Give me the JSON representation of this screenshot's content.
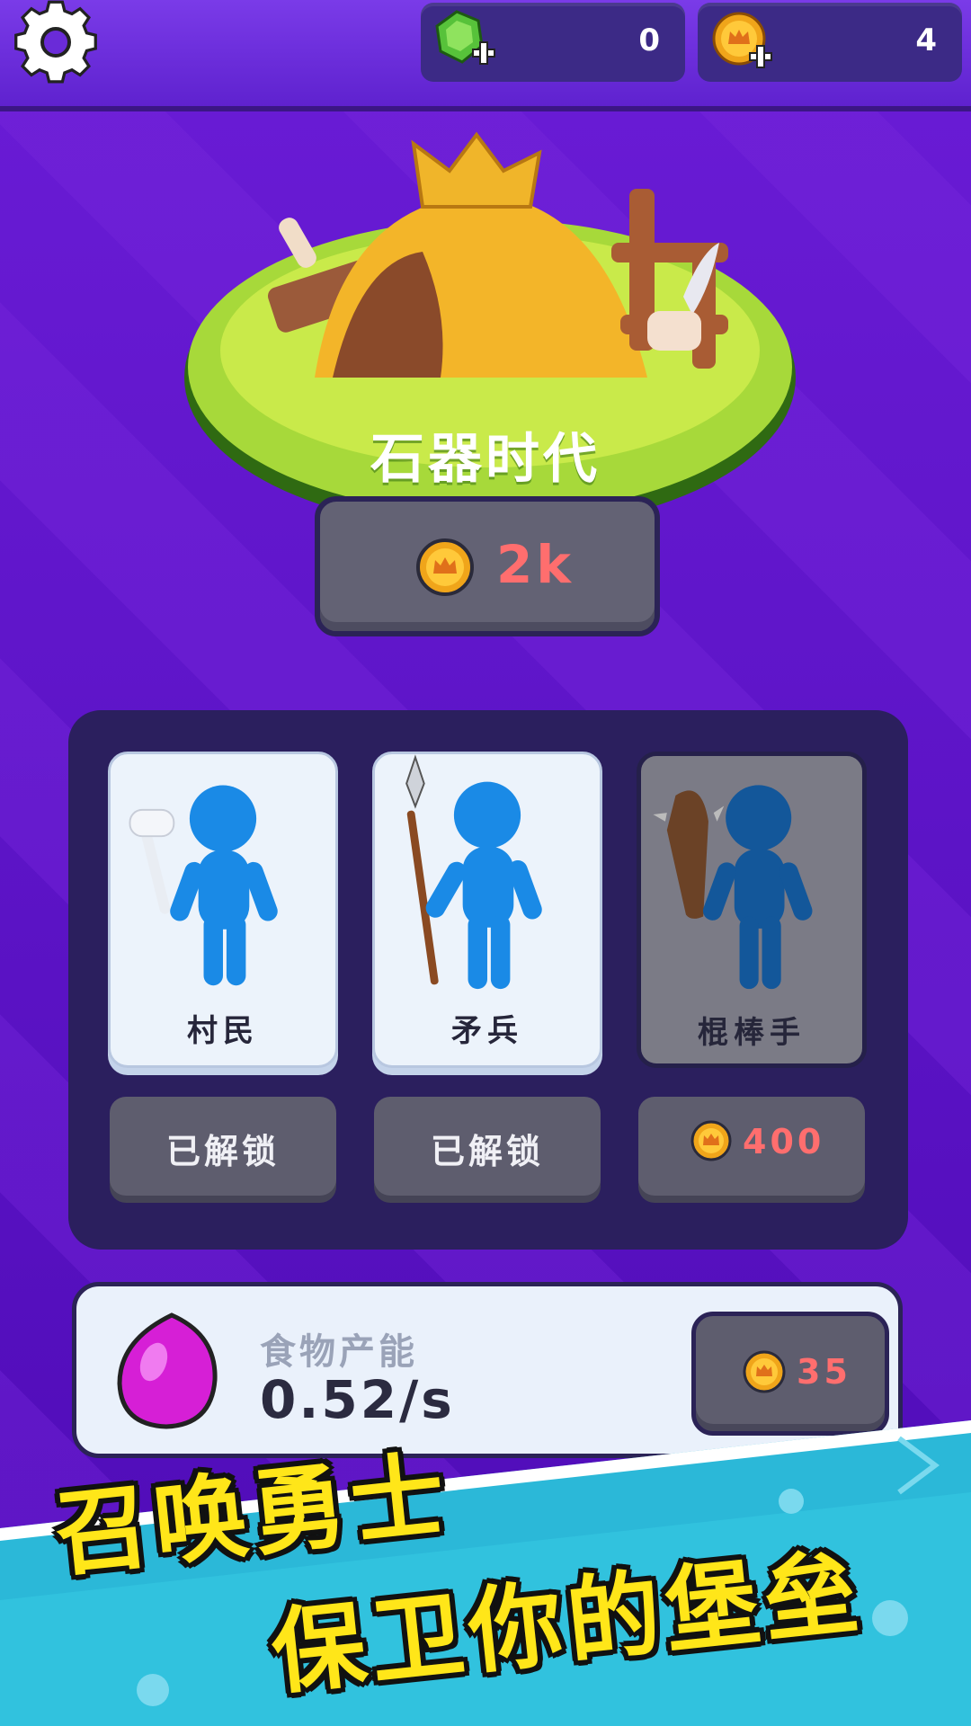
{
  "resources": {
    "gems": "0",
    "coins": "4"
  },
  "era": {
    "title": "石器时代",
    "price": "2k"
  },
  "units": [
    {
      "name": "村民",
      "status": "已解锁",
      "locked": false
    },
    {
      "name": "矛兵",
      "status": "已解锁",
      "locked": false
    },
    {
      "name": "棍棒手",
      "cost": "400",
      "locked": true
    }
  ],
  "food": {
    "label": "食物产能",
    "rate": "0.52/s",
    "upgrade_cost": "35"
  },
  "promo": {
    "line1": "召唤勇士",
    "line2": "保卫你的堡垒"
  },
  "colors": {
    "background": "#5b10c4",
    "panel": "#2b1f5e",
    "price_text": "#ff6e6e",
    "slogan": "#ffe619"
  }
}
